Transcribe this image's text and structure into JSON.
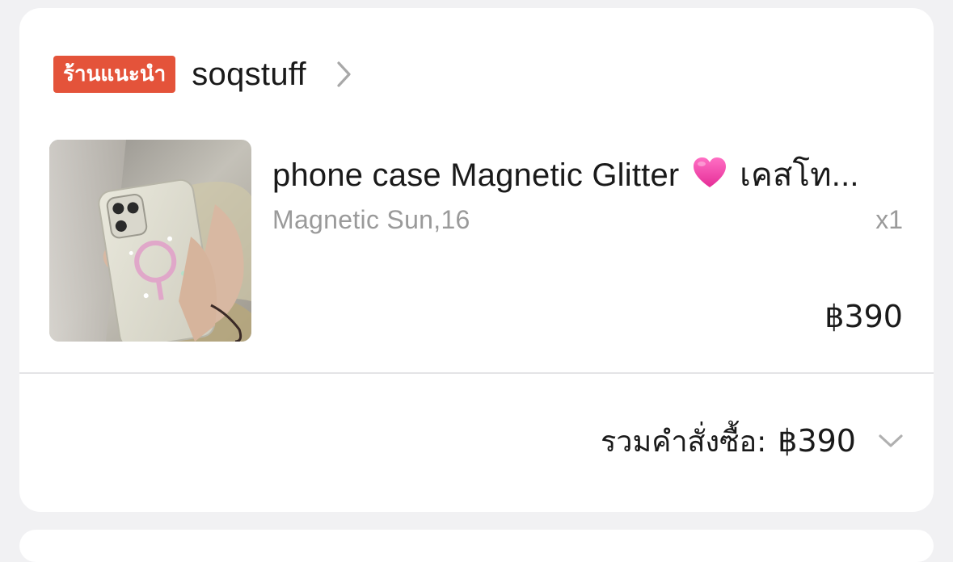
{
  "shop": {
    "badge": "ร้านแนะนำ",
    "name": "soqstuff",
    "chevron_icon": "chevron-right-icon"
  },
  "product": {
    "title_prefix": "phone case Magnetic Glitter",
    "title_emoji": "heart-icon",
    "title_suffix": "เคสโท...",
    "variant": "Magnetic Sun,16",
    "quantity": "x1",
    "price": "฿390"
  },
  "total": {
    "label": "รวมคำสั่งซื้อ:",
    "value": "฿390",
    "chevron_icon": "chevron-down-icon"
  },
  "colors": {
    "badge": "#e4533a",
    "heart": "#ff4fb0",
    "muted_text": "#9a9a9a",
    "background": "#f1f1f3"
  }
}
